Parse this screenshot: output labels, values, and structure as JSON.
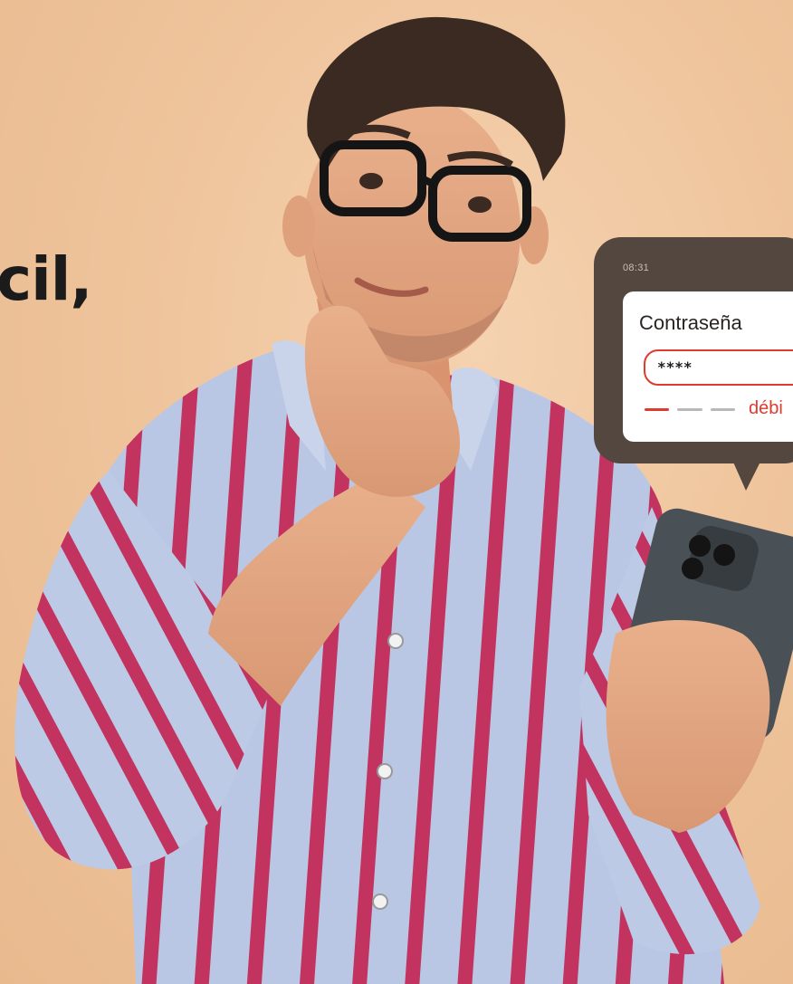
{
  "headline": {
    "visible_fragment": "cil,"
  },
  "notification": {
    "time": "08:31",
    "field_label": "Contraseña",
    "password_value": "****",
    "strength_label": "débi",
    "strength_level": 0.33
  },
  "colors": {
    "background": "#efc7a1",
    "bubble": "#54473f",
    "accent_red": "#e03a2e",
    "shirt_stripe": "#c2335f",
    "shirt_base": "#b8c6e3"
  },
  "photo": {
    "subject": "man-with-glasses-holding-phone"
  }
}
